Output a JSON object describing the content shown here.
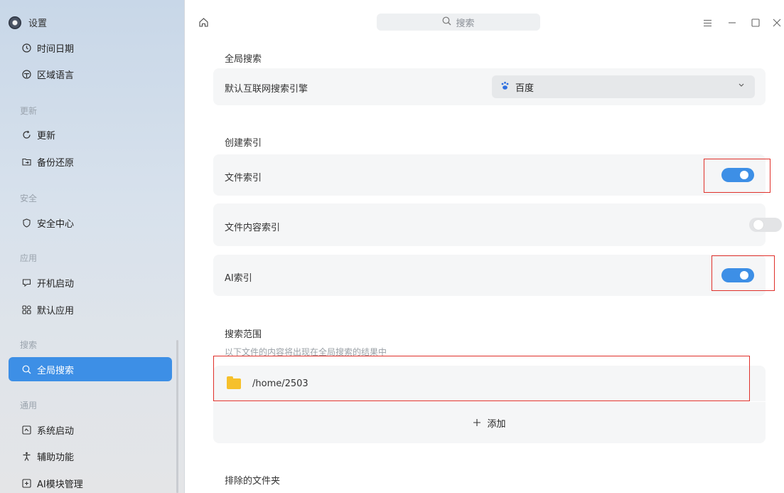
{
  "app": {
    "title": "设置"
  },
  "sidebar": {
    "items": [
      {
        "label": "时间日期",
        "icon": "clock-icon"
      },
      {
        "label": "区域语言",
        "icon": "globe-icon"
      },
      {
        "section": "更新"
      },
      {
        "label": "更新",
        "icon": "refresh-icon"
      },
      {
        "label": "备份还原",
        "icon": "backup-icon"
      },
      {
        "section": "安全"
      },
      {
        "label": "安全中心",
        "icon": "shield-icon"
      },
      {
        "section": "应用"
      },
      {
        "label": "开机启动",
        "icon": "autostart-icon"
      },
      {
        "label": "默认应用",
        "icon": "apps-grid-icon"
      },
      {
        "section": "搜索"
      },
      {
        "label": "全局搜索",
        "icon": "search-icon",
        "active": true
      },
      {
        "section": "通用"
      },
      {
        "label": "系统启动",
        "icon": "boot-icon"
      },
      {
        "label": "辅助功能",
        "icon": "accessibility-icon"
      },
      {
        "label": "AI模块管理",
        "icon": "ai-module-icon"
      }
    ]
  },
  "titlebar": {
    "search_placeholder": "搜索"
  },
  "main": {
    "global_search": {
      "title": "全局搜索",
      "engine_label": "默认互联网搜索引擎",
      "engine_value": "百度"
    },
    "index": {
      "title": "创建索引",
      "file_index": {
        "label": "文件索引",
        "enabled": true
      },
      "content_index": {
        "label": "文件内容索引",
        "enabled": false
      },
      "ai_index": {
        "label": "AI索引",
        "enabled": true
      }
    },
    "scope": {
      "title": "搜索范围",
      "hint": "以下文件的内容将出现在全局搜索的结果中",
      "folder": "/home/2503",
      "add_label": "添加"
    },
    "exclude": {
      "title": "排除的文件夹"
    }
  },
  "colors": {
    "accent": "#3d8fe6",
    "highlight": "#e0302a"
  }
}
